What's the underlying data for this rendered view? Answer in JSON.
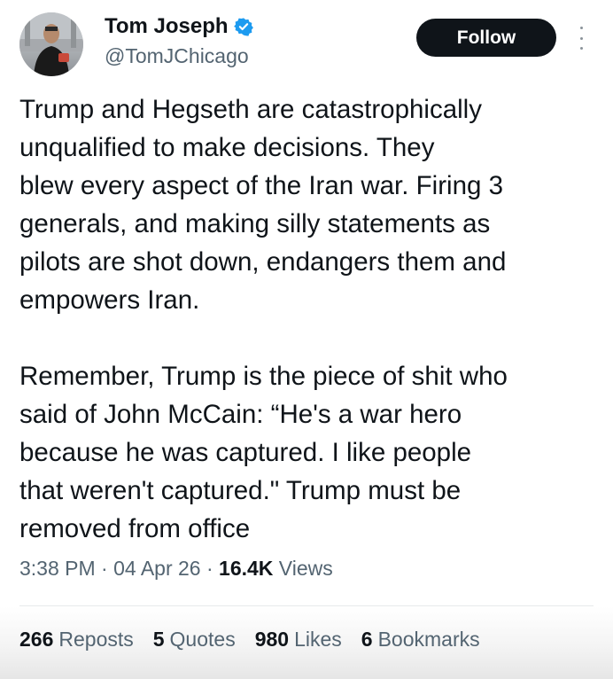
{
  "author": {
    "name": "Tom Joseph",
    "handle": "@TomJChicago"
  },
  "follow_label": "Follow",
  "tweet": {
    "lines_p1": [
      "Trump and Hegseth are catastrophically",
      "unqualified to make decisions. They",
      "blew every aspect of the Iran war. Firing 3",
      "generals, and making silly statements as",
      "pilots are shot down, endangers them and",
      "empowers Iran."
    ],
    "lines_p2": [
      "Remember, Trump is the piece of shit who",
      "said of John McCain: “He's a war hero",
      "because he was captured. I like people",
      "that weren't captured.\" Trump must be",
      "removed from office"
    ]
  },
  "meta": {
    "time": "3:38 PM",
    "date": "04 Apr 26",
    "views_count": "16.4K",
    "views_label": "Views"
  },
  "stats": {
    "reposts_count": "266",
    "reposts_label": "Reposts",
    "quotes_count": "5",
    "quotes_label": "Quotes",
    "likes_count": "980",
    "likes_label": "Likes",
    "bookmarks_count": "6",
    "bookmarks_label": "Bookmarks"
  },
  "icons": {
    "verified": "verified-badge-icon",
    "more": "more-vertical-icon"
  },
  "colors": {
    "verified_blue": "#1d9bf0",
    "follow_bg": "#0f1419",
    "secondary_text": "#536471"
  }
}
